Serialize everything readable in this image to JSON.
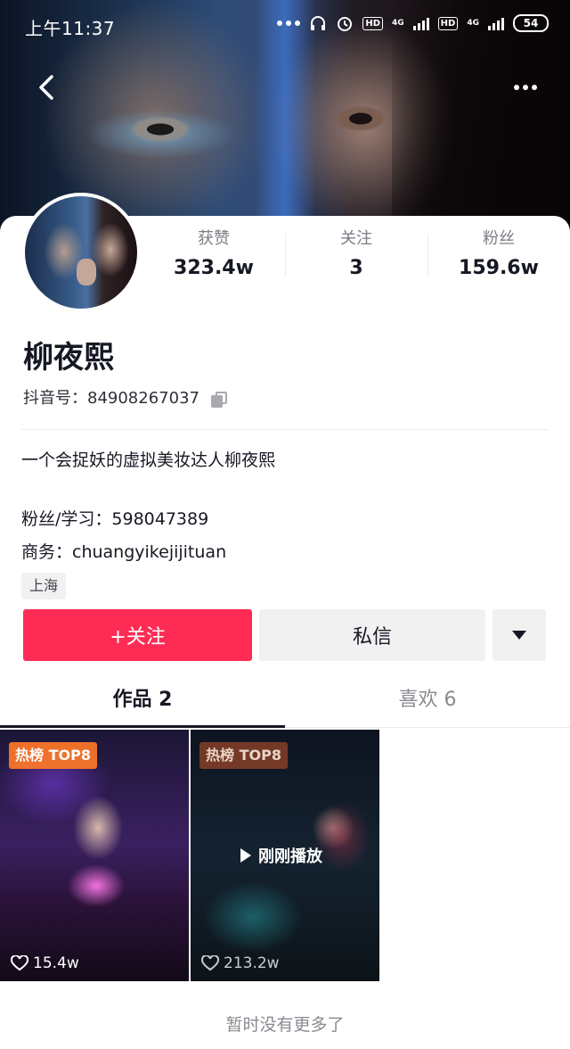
{
  "status_bar": {
    "time": "上午11:37",
    "net1": "4G",
    "net2": "4G",
    "hd": "HD",
    "battery": "54"
  },
  "profile": {
    "stats": [
      {
        "label": "获赞",
        "value": "323.4w"
      },
      {
        "label": "关注",
        "value": "3"
      },
      {
        "label": "粉丝",
        "value": "159.6w"
      }
    ],
    "nickname": "柳夜熙",
    "douyin_id": "抖音号：84908267037",
    "bio": "一个会捉妖的虚拟美妆达人柳夜熙",
    "fans_group": "粉丝/学习：598047389",
    "business": "商务：chuangyikejijituan",
    "location": "上海"
  },
  "actions": {
    "follow": "+关注",
    "message": "私信"
  },
  "tabs": [
    {
      "label": "作品 2",
      "active": true
    },
    {
      "label": "喜欢 6",
      "active": false
    }
  ],
  "videos": [
    {
      "badge": "热榜 TOP8",
      "likes": "15.4w",
      "overlay": ""
    },
    {
      "badge": "热榜 TOP8",
      "likes": "213.2w",
      "overlay": "刚刚播放"
    }
  ],
  "footer": "暂时没有更多了",
  "colors": {
    "accent": "#fe2c55",
    "text": "#161823",
    "secondary": "#8a8b91"
  }
}
